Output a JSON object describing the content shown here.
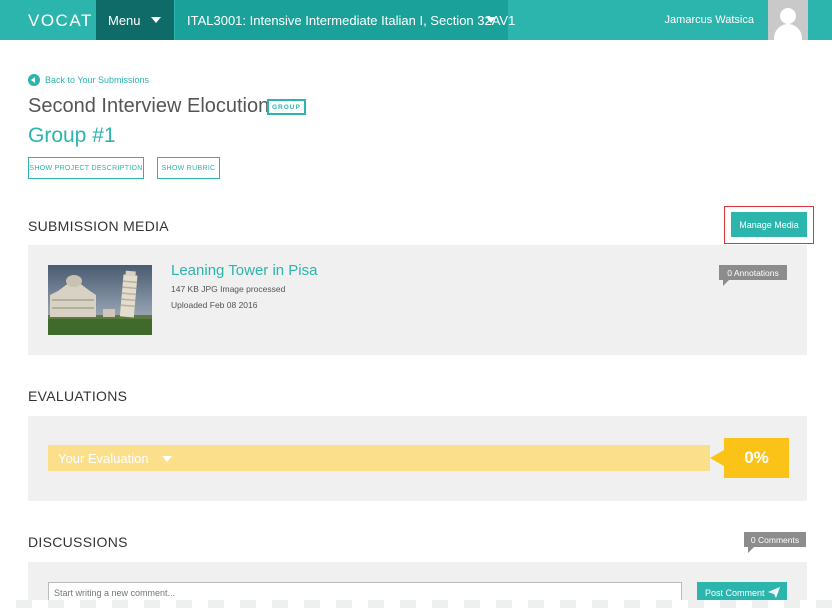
{
  "topbar": {
    "logo": "VOCAT",
    "menu_label": "Menu",
    "course_label": "ITAL3001: Intensive Intermediate Italian I, Section 32AV1",
    "user_name": "Jamarcus Watsica",
    "color": "#2cb5ad"
  },
  "header": {
    "back_link": "Back to Your Submissions",
    "title": "Second Interview Elocution",
    "badge": "GROUP",
    "group_name": "Group #1",
    "show_description": "SHOW PROJECT DESCRIPTION",
    "show_rubric": "SHOW RUBRIC"
  },
  "submission_media": {
    "heading": "SUBMISSION MEDIA",
    "manage_label": "Manage Media",
    "media": {
      "title": "Leaning Tower in Pisa",
      "meta": "147 KB JPG Image processed",
      "uploaded": "Uploaded Feb 08 2016",
      "annotations": "0 Annotations",
      "thumbnail_icon": "pisa-photo-thumbnail"
    }
  },
  "evaluations": {
    "heading": "EVALUATIONS",
    "your_evaluation": "Your Evaluation",
    "score": "0%"
  },
  "discussions": {
    "heading": "DISCUSSIONS",
    "comments": "0 Comments",
    "comment_placeholder": "Start writing a new comment...",
    "post_label": "Post Comment"
  },
  "colors": {
    "accent": "#2cb5ad",
    "eval_bar": "#fcdf8a",
    "eval_score": "#fbc318",
    "highlight": "#e0323b"
  }
}
